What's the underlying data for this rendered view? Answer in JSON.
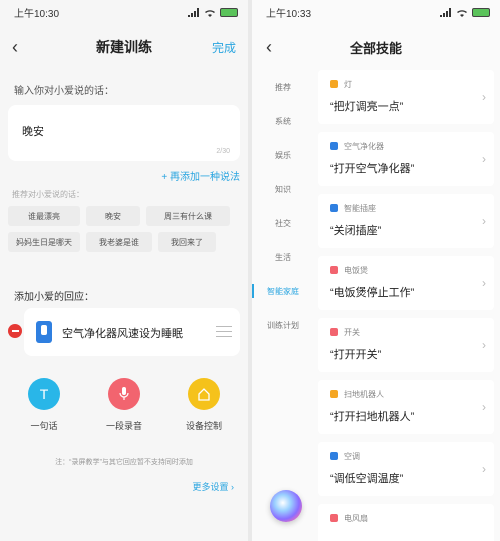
{
  "left": {
    "status_time": "上午10:30",
    "title": "新建训练",
    "done": "完成",
    "input_label": "输入你对小爱说的话：",
    "input_value": "晚安",
    "input_count": "2/30",
    "add_more": "+ 再添加一种说法",
    "suggest_label": "推荐对小爱说的话：",
    "suggestions": [
      "谁最漂亮",
      "晚安",
      "周三有什么课",
      "妈妈生日是哪天",
      "我老婆是谁",
      "我回来了"
    ],
    "response_label": "添加小爱的回应：",
    "response_text": "空气净化器风速设为睡眠",
    "actions": [
      {
        "label": "一句话",
        "icon": "text-icon",
        "color": "#29b6e8"
      },
      {
        "label": "一段录音",
        "icon": "microphone-icon",
        "color": "#f2646f"
      },
      {
        "label": "设备控制",
        "icon": "home-icon",
        "color": "#f5c21b"
      }
    ],
    "note": "注：“录屏教学”与其它回应暂不支持同时添加",
    "more_settings": "更多设置 ›"
  },
  "right": {
    "status_time": "上午10:33",
    "title": "全部技能",
    "categories": [
      "推荐",
      "系统",
      "娱乐",
      "知识",
      "社交",
      "生活",
      "智能家庭",
      "训练计划"
    ],
    "active_category": "智能家庭",
    "skills": [
      {
        "category": "灯",
        "command": "“把灯调亮一点”",
        "color": "#f5a623"
      },
      {
        "category": "空气净化器",
        "command": "“打开空气净化器”",
        "color": "#2f7fe0"
      },
      {
        "category": "智能插座",
        "command": "“关闭插座”",
        "color": "#2f7fe0"
      },
      {
        "category": "电饭煲",
        "command": "“电饭煲停止工作”",
        "color": "#f2646f"
      },
      {
        "category": "开关",
        "command": "“打开开关”",
        "color": "#f2646f"
      },
      {
        "category": "扫地机器人",
        "command": "“打开扫地机器人”",
        "color": "#f5a623"
      },
      {
        "category": "空调",
        "command": "“调低空调温度”",
        "color": "#2f7fe0"
      },
      {
        "category": "电风扇",
        "command": "",
        "color": "#f2646f"
      }
    ]
  }
}
